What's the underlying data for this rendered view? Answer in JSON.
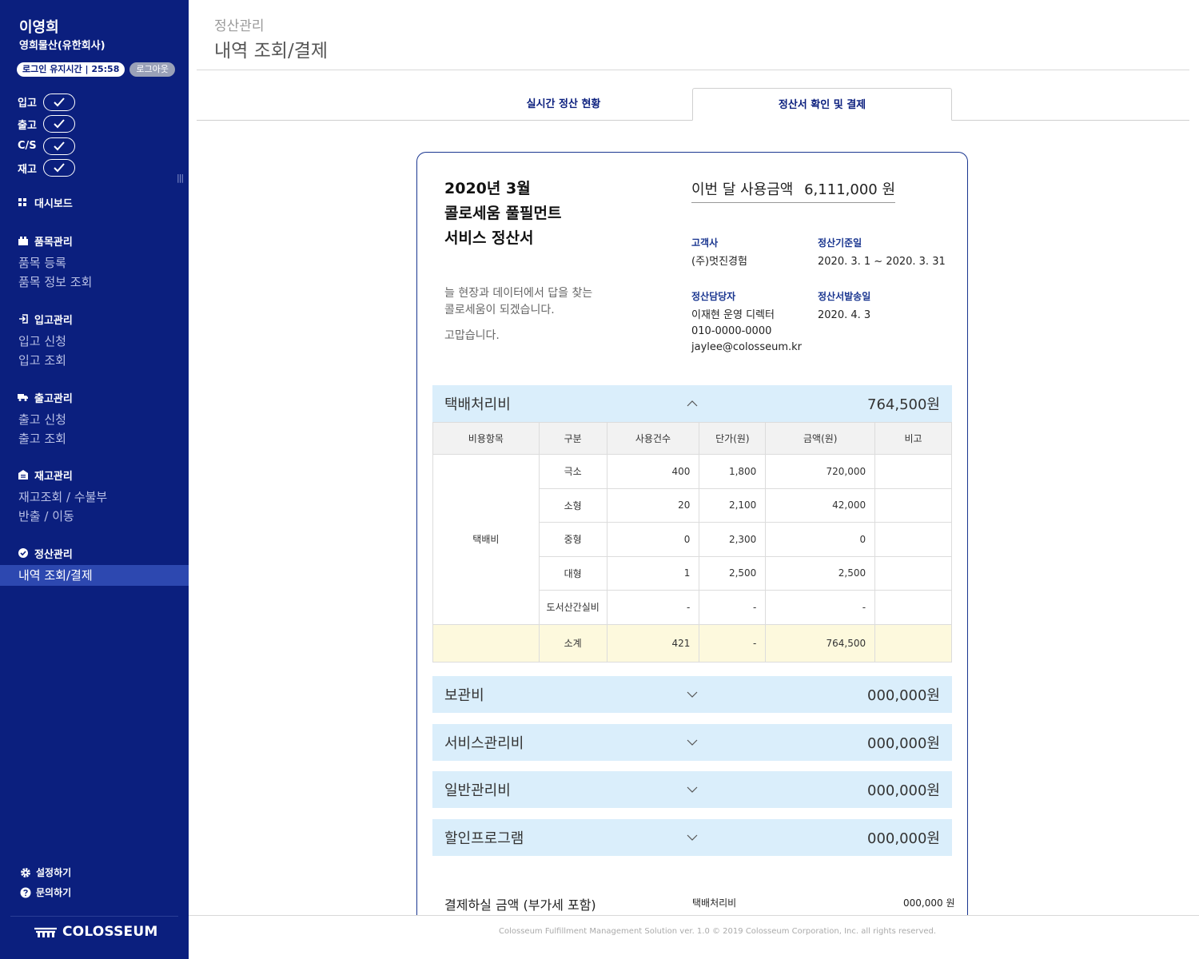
{
  "user": {
    "name": "이영희",
    "company": "영희물산(유한회사)"
  },
  "session": {
    "label": "로그인 유지시간 | 25:58",
    "logout": "로그아웃"
  },
  "checks": [
    {
      "label": "입고"
    },
    {
      "label": "출고"
    },
    {
      "label": "C/S"
    },
    {
      "label": "재고"
    }
  ],
  "nav": {
    "dashboard": "대시보드",
    "product": {
      "title": "품목관리",
      "items": [
        "품목 등록",
        "품목 정보 조회"
      ]
    },
    "inbound": {
      "title": "입고관리",
      "items": [
        "입고 신청",
        "입고 조회"
      ]
    },
    "outbound": {
      "title": "출고관리",
      "items": [
        "출고 신청",
        "출고 조회"
      ]
    },
    "inventory": {
      "title": "재고관리",
      "items": [
        "재고조회 / 수불부",
        "반출 / 이동"
      ]
    },
    "settlement": {
      "title": "정산관리",
      "active": "내역 조회/결제"
    }
  },
  "bottom": {
    "settings": "설정하기",
    "inquiry": "문의하기",
    "brand": "COLOSSEUM"
  },
  "header": {
    "crumb": "정산관리",
    "title": "내역 조회/결제"
  },
  "tabs": {
    "realtime": "실시간 정산 현황",
    "invoice": "정산서 확인 및 결제"
  },
  "invoice": {
    "title_lines": [
      "2020년 3월",
      "콜로세움 풀필먼트",
      "서비스 정산서"
    ],
    "message_lines": [
      "늘 현장과 데이터에서 답을 찾는",
      "콜로세움이 되겠습니다."
    ],
    "thanks": "고맙습니다.",
    "usage_label": "이번 달 사용금액",
    "usage_amount": "6,111,000 원",
    "customer_label": "고객사",
    "customer": "(주)멋진경험",
    "period_label": "정산기준일",
    "period": "2020. 3. 1 ~ 2020. 3. 31",
    "manager_label": "정산담당자",
    "manager_name": "이재현 운영 디렉터",
    "manager_phone": "010-0000-0000",
    "manager_email": " jaylee@colosseum.kr",
    "sent_label": "정산서발송일",
    "sent_date": "2020. 4. 3"
  },
  "delivery": {
    "label": "택배처리비",
    "amount": "764,500원",
    "headers": [
      "비용항목",
      "구분",
      "사용건수",
      "단가(원)",
      "금액(원)",
      "비고"
    ],
    "item": "택배비",
    "rows": [
      {
        "type": "극소",
        "count": "400",
        "unit": "1,800",
        "amount": "720,000",
        "note": ""
      },
      {
        "type": "소형",
        "count": "20",
        "unit": "2,100",
        "amount": "42,000",
        "note": ""
      },
      {
        "type": "중형",
        "count": "0",
        "unit": "2,300",
        "amount": "0",
        "note": ""
      },
      {
        "type": "대형",
        "count": "1",
        "unit": "2,500",
        "amount": "2,500",
        "note": ""
      },
      {
        "type": "도서산간실비",
        "count": "-",
        "unit": "-",
        "amount": "-",
        "note": ""
      }
    ],
    "subtotal": {
      "type": "소계",
      "count": "421",
      "unit": "-",
      "amount": "764,500",
      "note": ""
    }
  },
  "sections": [
    {
      "label": "보관비",
      "amount": "000,000원"
    },
    {
      "label": "서비스관리비",
      "amount": "000,000원"
    },
    {
      "label": "일반관리비",
      "amount": "000,000원"
    },
    {
      "label": "할인프로그램",
      "amount": "000,000원"
    }
  ],
  "payment": {
    "label": "결제하실 금액 (부가세 포함)",
    "item": "택배처리비",
    "amount": "000,000 원"
  },
  "footer": {
    "text": "Colosseum Fulfillment Management Solution ver. 1.0    © 2019 Colosseum Corporation, Inc. all rights reserved."
  },
  "colors": {
    "sidebar": "#0b1f7e",
    "active_nav": "#2d48b0",
    "accordion": "#daeefb",
    "subtotal": "#fdf9dd",
    "accent": "#1a3690"
  }
}
